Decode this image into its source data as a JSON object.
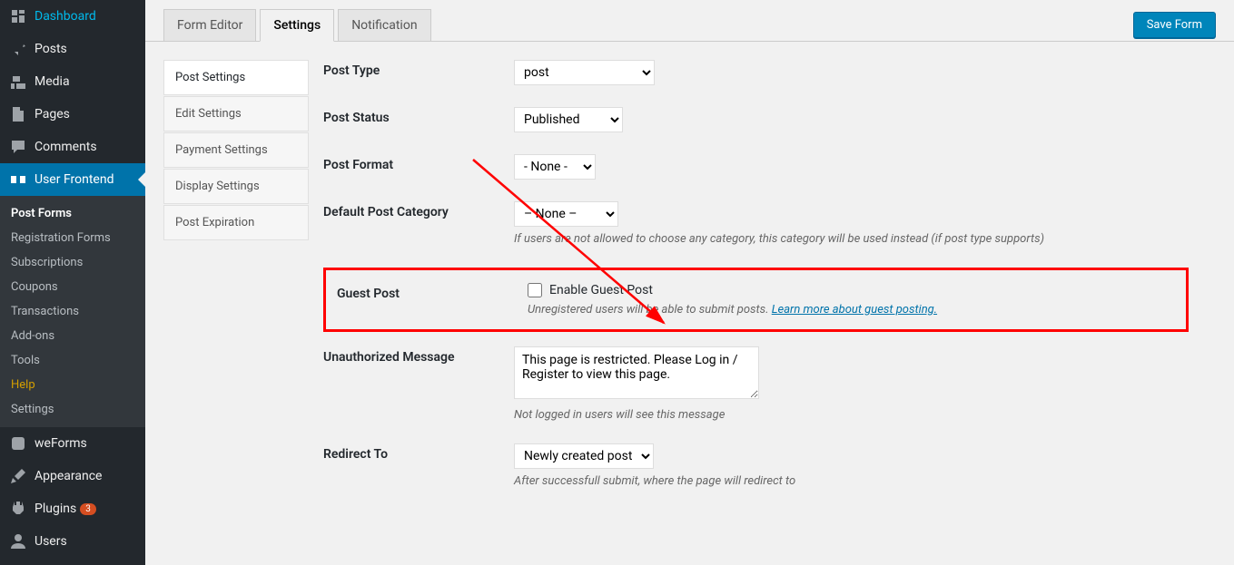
{
  "sidebar": {
    "items": [
      {
        "label": "Dashboard",
        "icon": "dashboard"
      },
      {
        "label": "Posts",
        "icon": "pin"
      },
      {
        "label": "Media",
        "icon": "media"
      },
      {
        "label": "Pages",
        "icon": "page"
      },
      {
        "label": "Comments",
        "icon": "comment"
      },
      {
        "label": "User Frontend",
        "icon": "userfrontend",
        "active": true
      },
      {
        "label": "weForms",
        "icon": "weforms"
      },
      {
        "label": "Appearance",
        "icon": "brush"
      },
      {
        "label": "Plugins",
        "icon": "plugin",
        "badge": "3"
      },
      {
        "label": "Users",
        "icon": "user"
      }
    ],
    "submenu": [
      {
        "label": "Post Forms",
        "current": true
      },
      {
        "label": "Registration Forms"
      },
      {
        "label": "Subscriptions"
      },
      {
        "label": "Coupons"
      },
      {
        "label": "Transactions"
      },
      {
        "label": "Add-ons"
      },
      {
        "label": "Tools"
      },
      {
        "label": "Help",
        "help": true
      },
      {
        "label": "Settings"
      }
    ]
  },
  "tabs": {
    "items": [
      {
        "label": "Form Editor"
      },
      {
        "label": "Settings",
        "active": true
      },
      {
        "label": "Notification"
      }
    ],
    "save_button": "Save Form"
  },
  "settings_nav": [
    {
      "label": "Post Settings",
      "active": true
    },
    {
      "label": "Edit Settings"
    },
    {
      "label": "Payment Settings"
    },
    {
      "label": "Display Settings"
    },
    {
      "label": "Post Expiration"
    }
  ],
  "form": {
    "post_type": {
      "label": "Post Type",
      "value": "post"
    },
    "post_status": {
      "label": "Post Status",
      "value": "Published"
    },
    "post_format": {
      "label": "Post Format",
      "value": "- None -"
    },
    "default_category": {
      "label": "Default Post Category",
      "value": "– None –",
      "desc": "If users are not allowed to choose any category, this category will be used instead (if post type supports)"
    },
    "guest_post": {
      "label": "Guest Post",
      "checkbox_label": "Enable Guest Post",
      "desc": "Unregistered users will be able to submit posts. ",
      "link": "Learn more about guest posting."
    },
    "unauthorized": {
      "label": "Unauthorized Message",
      "value": "This page is restricted. Please Log in / Register to view this page.",
      "desc": "Not logged in users will see this message"
    },
    "redirect": {
      "label": "Redirect To",
      "value": "Newly created post",
      "desc": "After successfull submit, where the page will redirect to"
    }
  }
}
